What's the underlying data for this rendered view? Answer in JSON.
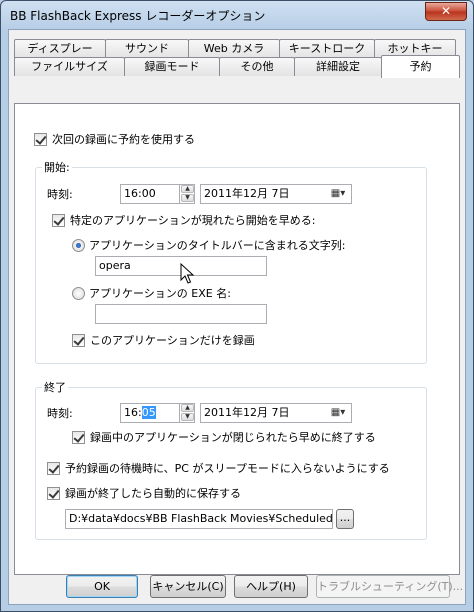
{
  "window": {
    "title": "BB FlashBack Express レコーダーオプション",
    "close_glyph": "✕"
  },
  "tabs": {
    "row1": [
      "ディスプレー",
      "サウンド",
      "Web カメラ",
      "キーストローク",
      "ホットキー"
    ],
    "row2": [
      "ファイルサイズ",
      "録画モード",
      "その他",
      "詳細設定",
      "予約"
    ],
    "active": "予約"
  },
  "schedule": {
    "use_schedule_label": "次回の録画に予約を使用する",
    "use_schedule_checked": true
  },
  "start": {
    "group_title": "開始:",
    "time_label": "時刻:",
    "time_value": "16:00",
    "date_value": "2011年12月  7日",
    "app_trigger_label": "特定のアプリケーションが現れたら開始を早める:",
    "app_trigger_checked": true,
    "title_radio_label": "アプリケーションのタイトルバーに含まれる文字列:",
    "title_radio_selected": true,
    "title_value": "opera",
    "exe_radio_label": "アプリケーションの EXE 名:",
    "exe_radio_selected": false,
    "exe_value": "",
    "only_this_app_label": "このアプリケーションだけを録画",
    "only_this_app_checked": true
  },
  "end": {
    "group_title": "終了",
    "time_label": "時刻:",
    "time_hour": "16:",
    "time_minute_selected": "05",
    "date_value": "2011年12月  7日",
    "stop_on_close_label": "録画中のアプリケーションが閉じられたら早めに終了する",
    "stop_on_close_checked": true,
    "no_sleep_label": "予約録画の待機時に、PC がスリープモードに入らないようにする",
    "no_sleep_checked": true,
    "autosave_label": "録画が終了したら自動的に保存する",
    "autosave_checked": true,
    "save_path": "D:¥data¥docs¥BB FlashBack Movies¥ScheduledRecord",
    "browse_label": "..."
  },
  "buttons": {
    "ok": "OK",
    "cancel": "キャンセル(C)",
    "help": "ヘルプ(H)",
    "troubleshoot": "トラブルシューティング(T)..."
  },
  "icons": {
    "spin_up": "▲",
    "spin_down": "▼",
    "calendar": "▦▾"
  }
}
